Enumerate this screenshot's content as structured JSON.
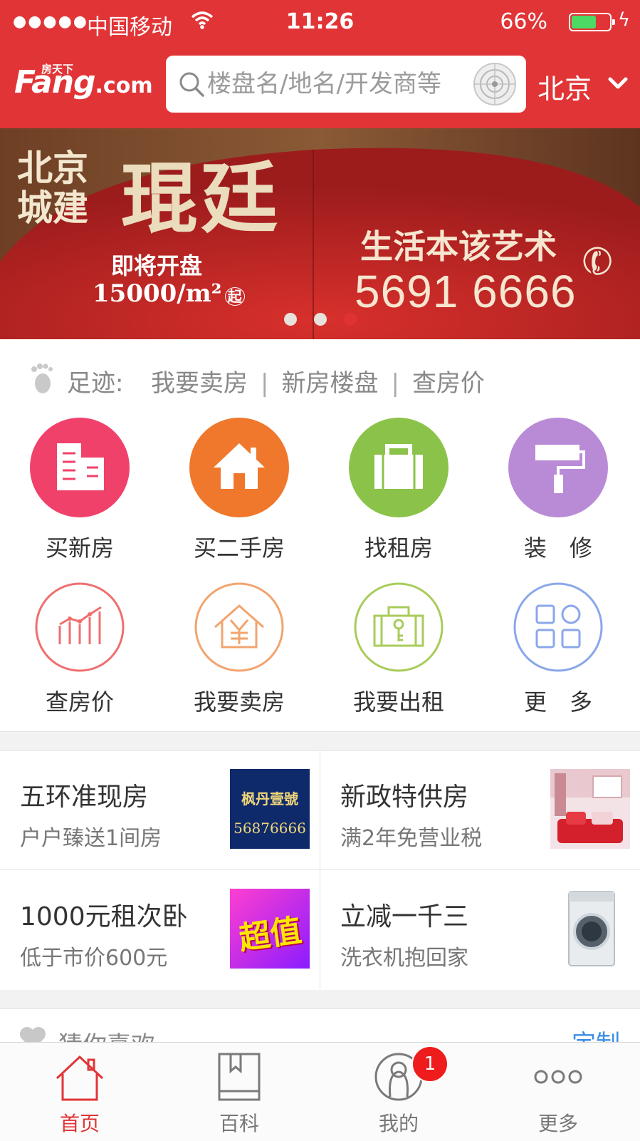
{
  "status_bar": {
    "signal": "●●●●●",
    "carrier": "中国移动",
    "time": "11:26",
    "battery": "66%",
    "battery_level": 0.66
  },
  "header": {
    "logo_small": "房天下",
    "logo_main": "Fang",
    "logo_suffix": ".com",
    "search_placeholder": "楼盘名/地名/开发商等",
    "city": "北京"
  },
  "banner": {
    "developer": "北京城建",
    "project": "琨廷",
    "opening": "即将开盘",
    "price": "15000/m²",
    "price_note": "起",
    "slogan": "生活本该艺术",
    "phone": "5691 6666",
    "page_count": 3,
    "active_page": 3
  },
  "footprint": {
    "label": "足迹:",
    "links": [
      "我要卖房",
      "新房楼盘",
      "查房价"
    ],
    "separator": "|"
  },
  "grid": {
    "items": [
      {
        "label": "买新房",
        "icon": "buildings-icon",
        "color": "#f0416a"
      },
      {
        "label": "买二手房",
        "icon": "house-icon",
        "color": "#f0782c"
      },
      {
        "label": "找租房",
        "icon": "suitcase-icon",
        "color": "#8bc34a"
      },
      {
        "label": "装　修",
        "icon": "paint-roller-icon",
        "color": "#b98bd6"
      },
      {
        "label": "查房价",
        "icon": "price-trend-icon",
        "color": "#ef6f6f"
      },
      {
        "label": "我要卖房",
        "icon": "sell-house-icon",
        "color": "#f2a46e"
      },
      {
        "label": "我要出租",
        "icon": "rent-key-icon",
        "color": "#a8cc5a"
      },
      {
        "label": "更　多",
        "icon": "more-grid-icon",
        "color": "#8aa7ea"
      }
    ]
  },
  "promos": [
    {
      "title": "五环准现房",
      "subtitle": "户户臻送1间房",
      "thumb_text": "枫丹壹號",
      "thumb_phone": "56876666"
    },
    {
      "title": "新政特供房",
      "subtitle": "满2年免营业税",
      "thumb": "living-room-photo"
    },
    {
      "title": "1000元租次卧",
      "subtitle": "低于市价600元",
      "thumb_text": "超值"
    },
    {
      "title": "立减一千三",
      "subtitle": "洗衣机抱回家",
      "thumb": "washing-machine-photo"
    }
  ],
  "guess": {
    "title": "猜你喜欢",
    "action": "定制"
  },
  "tabbar": {
    "tabs": [
      {
        "label": "首页",
        "active": true
      },
      {
        "label": "百科",
        "active": false
      },
      {
        "label": "我的",
        "active": false,
        "badge": "1"
      },
      {
        "label": "更多",
        "active": false
      }
    ]
  },
  "colors": {
    "brand_red": "#e13436",
    "link_blue": "#3a8ee6",
    "badge_red": "#ee1c1c"
  }
}
